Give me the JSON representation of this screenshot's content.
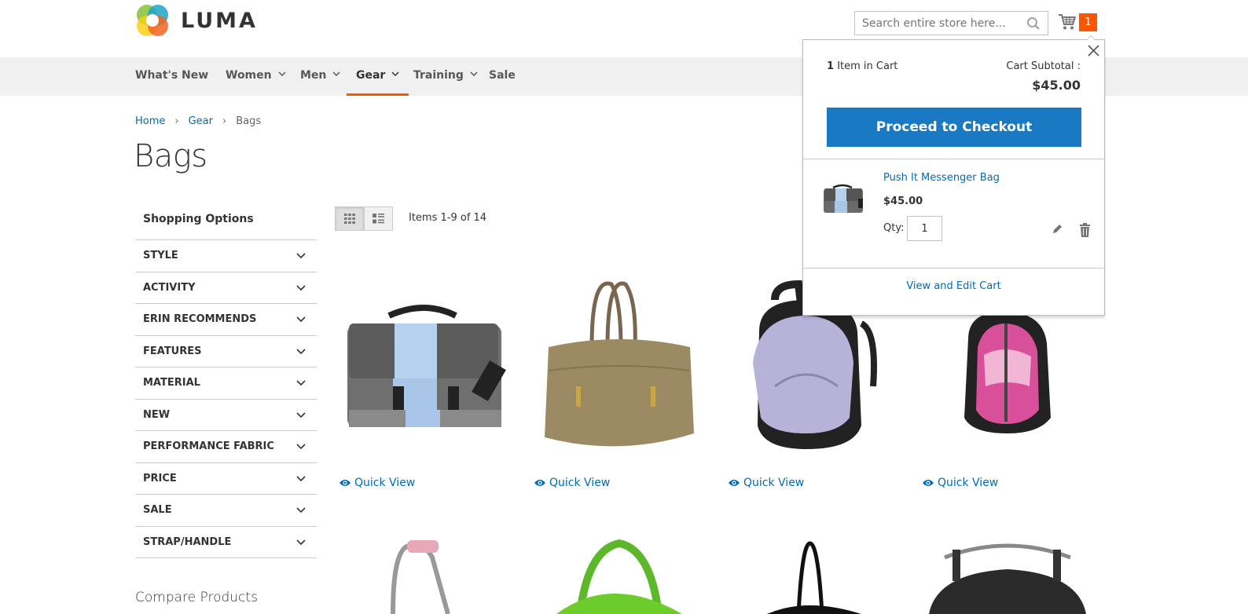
{
  "brand": {
    "name": "LUMA"
  },
  "search": {
    "placeholder": "Search entire store here..."
  },
  "minicart": {
    "count": "1"
  },
  "nav": [
    {
      "label": "What's New",
      "has_children": false,
      "active": false
    },
    {
      "label": "Women",
      "has_children": true,
      "active": false
    },
    {
      "label": "Men",
      "has_children": true,
      "active": false
    },
    {
      "label": "Gear",
      "has_children": true,
      "active": true
    },
    {
      "label": "Training",
      "has_children": true,
      "active": false
    },
    {
      "label": "Sale",
      "has_children": false,
      "active": false
    }
  ],
  "breadcrumb": {
    "home": "Home",
    "gear": "Gear",
    "current": "Bags",
    "separator": "›"
  },
  "page": {
    "title": "Bags"
  },
  "sidebar": {
    "title": "Shopping Options",
    "filters": [
      "Style",
      "Activity",
      "Erin Recommends",
      "Features",
      "Material",
      "New",
      "Performance Fabric",
      "Price",
      "Sale",
      "Strap/Handle"
    ],
    "compare_title": "Compare Products"
  },
  "toolbar": {
    "amount": "Items 1-9 of 14",
    "mode": "grid"
  },
  "products": [
    {
      "quick_view": "Quick View",
      "image": "grey-blue-messenger-bag"
    },
    {
      "quick_view": "Quick View",
      "image": "tan-duffle-tote"
    },
    {
      "quick_view": "Quick View",
      "image": "lavender-backpack"
    },
    {
      "quick_view": "Quick View",
      "image": "pink-black-backpack"
    }
  ],
  "minicart_dropdown": {
    "count_number": "1",
    "count_text": "Item in Cart",
    "subtotal_label": "Cart Subtotal :",
    "subtotal": "$45.00",
    "checkout_label": "Proceed to Checkout",
    "item": {
      "name": "Push It Messenger Bag",
      "price": "$45.00",
      "qty_label": "Qty:",
      "qty": "1"
    },
    "view_cart": "View and Edit Cart"
  },
  "colors": {
    "accent": "#ff5501",
    "primary": "#1979c3",
    "link": "#006bb4"
  }
}
